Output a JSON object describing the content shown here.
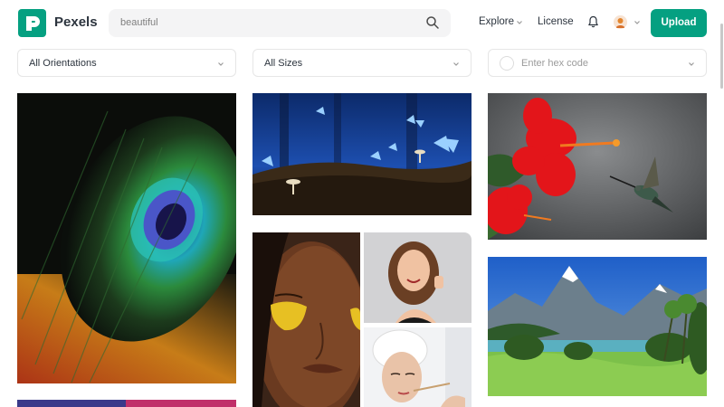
{
  "brand": {
    "name": "Pexels"
  },
  "search": {
    "value": "beautiful"
  },
  "nav": {
    "explore": "Explore",
    "license": "License",
    "upload": "Upload"
  },
  "filters": {
    "orientation": "All Orientations",
    "size": "All Sizes",
    "color_placeholder": "Enter hex code"
  },
  "icons": {
    "logo": "pexels-logo-icon",
    "search": "search-icon",
    "bell": "bell-icon",
    "chevron": "chevron-down-icon"
  },
  "colors": {
    "brand": "#05a081",
    "text": "#2c343e",
    "search_bg": "#f4f4f5",
    "border": "#e6e6e6"
  }
}
